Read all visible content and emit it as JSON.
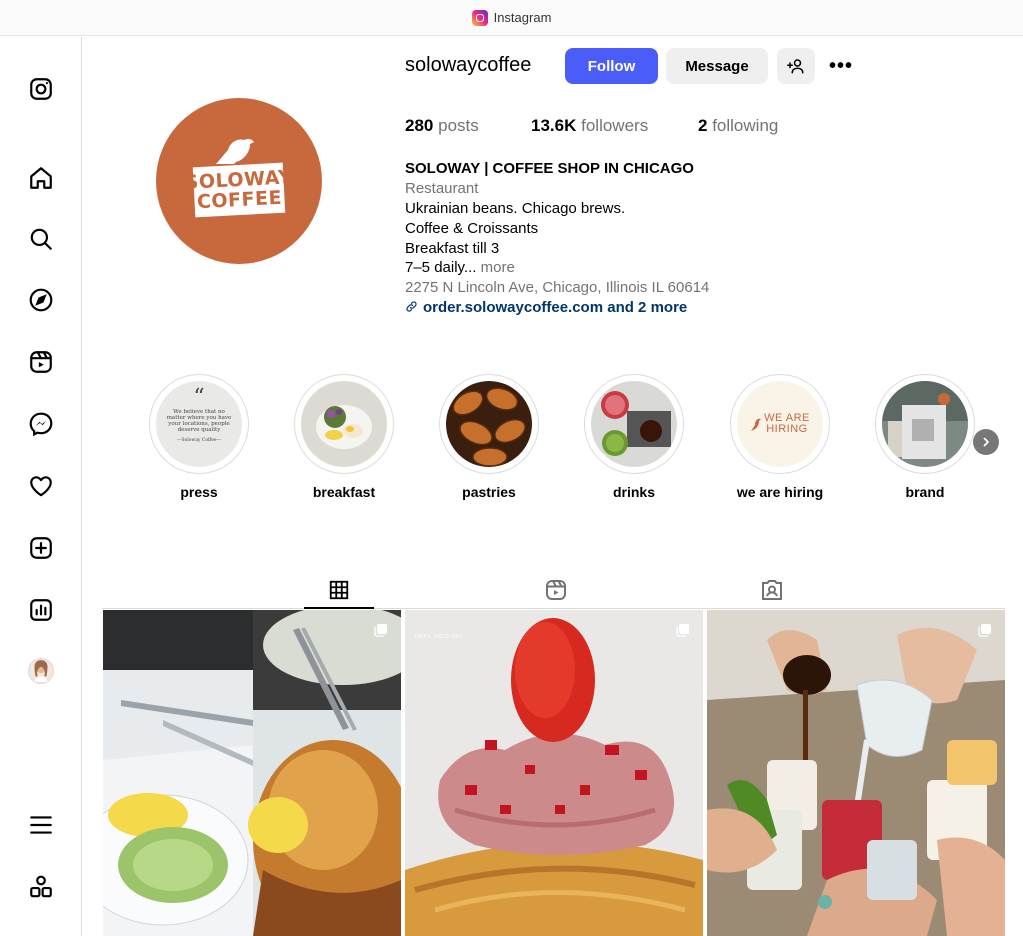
{
  "window": {
    "title": "Instagram"
  },
  "profile": {
    "username": "solowaycoffee",
    "avatar_text_line1": "SOLOWAY",
    "avatar_text_line2": "COFFEE",
    "follow_label": "Follow",
    "message_label": "Message",
    "more_label": "•••",
    "stats": {
      "posts_count": "280",
      "posts_label": "posts",
      "followers_count": "13.6K",
      "followers_label": "followers",
      "following_count": "2",
      "following_label": "following"
    },
    "bio": {
      "name": "SOLOWAY | COFFEE SHOP IN CHICAGO",
      "category": "Restaurant",
      "line1": "Ukrainian beans. Chicago brews.",
      "line2": "Coffee & Croissants",
      "line3": "Breakfast till 3",
      "line4": "7–5 daily...",
      "more": "more",
      "address": "2275 N Lincoln Ave, Chicago, Illinois IL 60614",
      "link": "order.solowaycoffee.com and 2 more"
    }
  },
  "highlights": [
    {
      "label": "press"
    },
    {
      "label": "breakfast"
    },
    {
      "label": "pastries"
    },
    {
      "label": "drinks"
    },
    {
      "label": "we are hiring"
    },
    {
      "label": "brand"
    }
  ],
  "press_card": {
    "quote": "“",
    "text": "We believe that no matter where you have your locations, people deserve quality",
    "sign": "—Soloway Coffee—"
  },
  "hiring_card": {
    "line1": "WE ARE",
    "line2": "HIRING"
  },
  "post2_caption": "UNTIL SOLD OUT",
  "colors": {
    "accent": "#4a5df9",
    "brand": "#c8683d",
    "link": "#00376b"
  },
  "icons": {
    "nav": [
      "instagram-icon",
      "home-icon",
      "search-icon",
      "explore-icon",
      "reels-icon",
      "messenger-icon",
      "heart-icon",
      "create-icon",
      "dashboard-icon",
      "profile-avatar",
      "menu-icon",
      "apps-icon"
    ],
    "tabs": [
      "grid-icon",
      "reels-tab-icon",
      "tagged-icon"
    ]
  }
}
